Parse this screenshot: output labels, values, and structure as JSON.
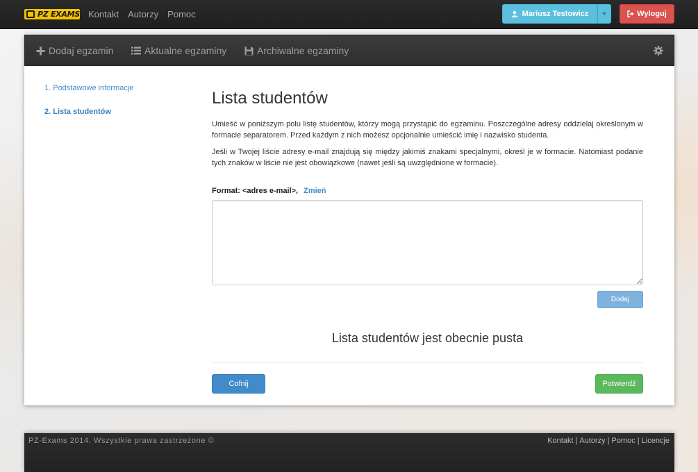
{
  "brand": {
    "logo_text": "PZ EXAMS",
    "accent": "#f2c200"
  },
  "topnav": {
    "items": [
      "Kontakt",
      "Autorzy",
      "Pomoc"
    ]
  },
  "user": {
    "name": "Mariusz Testowicz",
    "logout_label": "Wyloguj"
  },
  "panel_nav": {
    "items": [
      {
        "label": "Dodaj egzamin",
        "icon": "plus-icon"
      },
      {
        "label": "Aktualne egzaminy",
        "icon": "list-icon"
      },
      {
        "label": "Archiwalne egzaminy",
        "icon": "floppy-icon"
      }
    ],
    "settings_icon": "gear-icon"
  },
  "steps": [
    {
      "label": "1. Podstawowe informacje",
      "active": false
    },
    {
      "label": "2. Lista studentów",
      "active": true
    }
  ],
  "main": {
    "title": "Lista studentów",
    "paragraph1": "Umieść w poniższym polu listę studentów, którzy mogą przystąpić do egzaminu. Poszczególne adresy oddzielaj określonym w formacie separatorem. Przed każdym z nich możesz opcjonalnie umieścić imię i nazwisko studenta.",
    "paragraph2": "Jeśli w Twojej liście adresy e-mail znajdują się między jakimiś znakami specjalnymi, określ je w formacie. Natomiast podanie tych znaków w liście nie jest obowiązkowe (nawet jeśli są uwzględnione w formacie).",
    "format_label": "Format: <adres e-mail>,",
    "format_change": "Zmień",
    "textarea_value": "",
    "add_label": "Dodaj",
    "empty_message": "Lista studentów jest obecnie pusta",
    "back_label": "Cofnij",
    "confirm_label": "Potwierdź"
  },
  "footer": {
    "copyright": "PZ-Exams 2014. Wszystkie prawa zastrzeżone ©",
    "links": [
      "Kontakt",
      "Autorzy",
      "Pomoc",
      "Licencje"
    ]
  }
}
